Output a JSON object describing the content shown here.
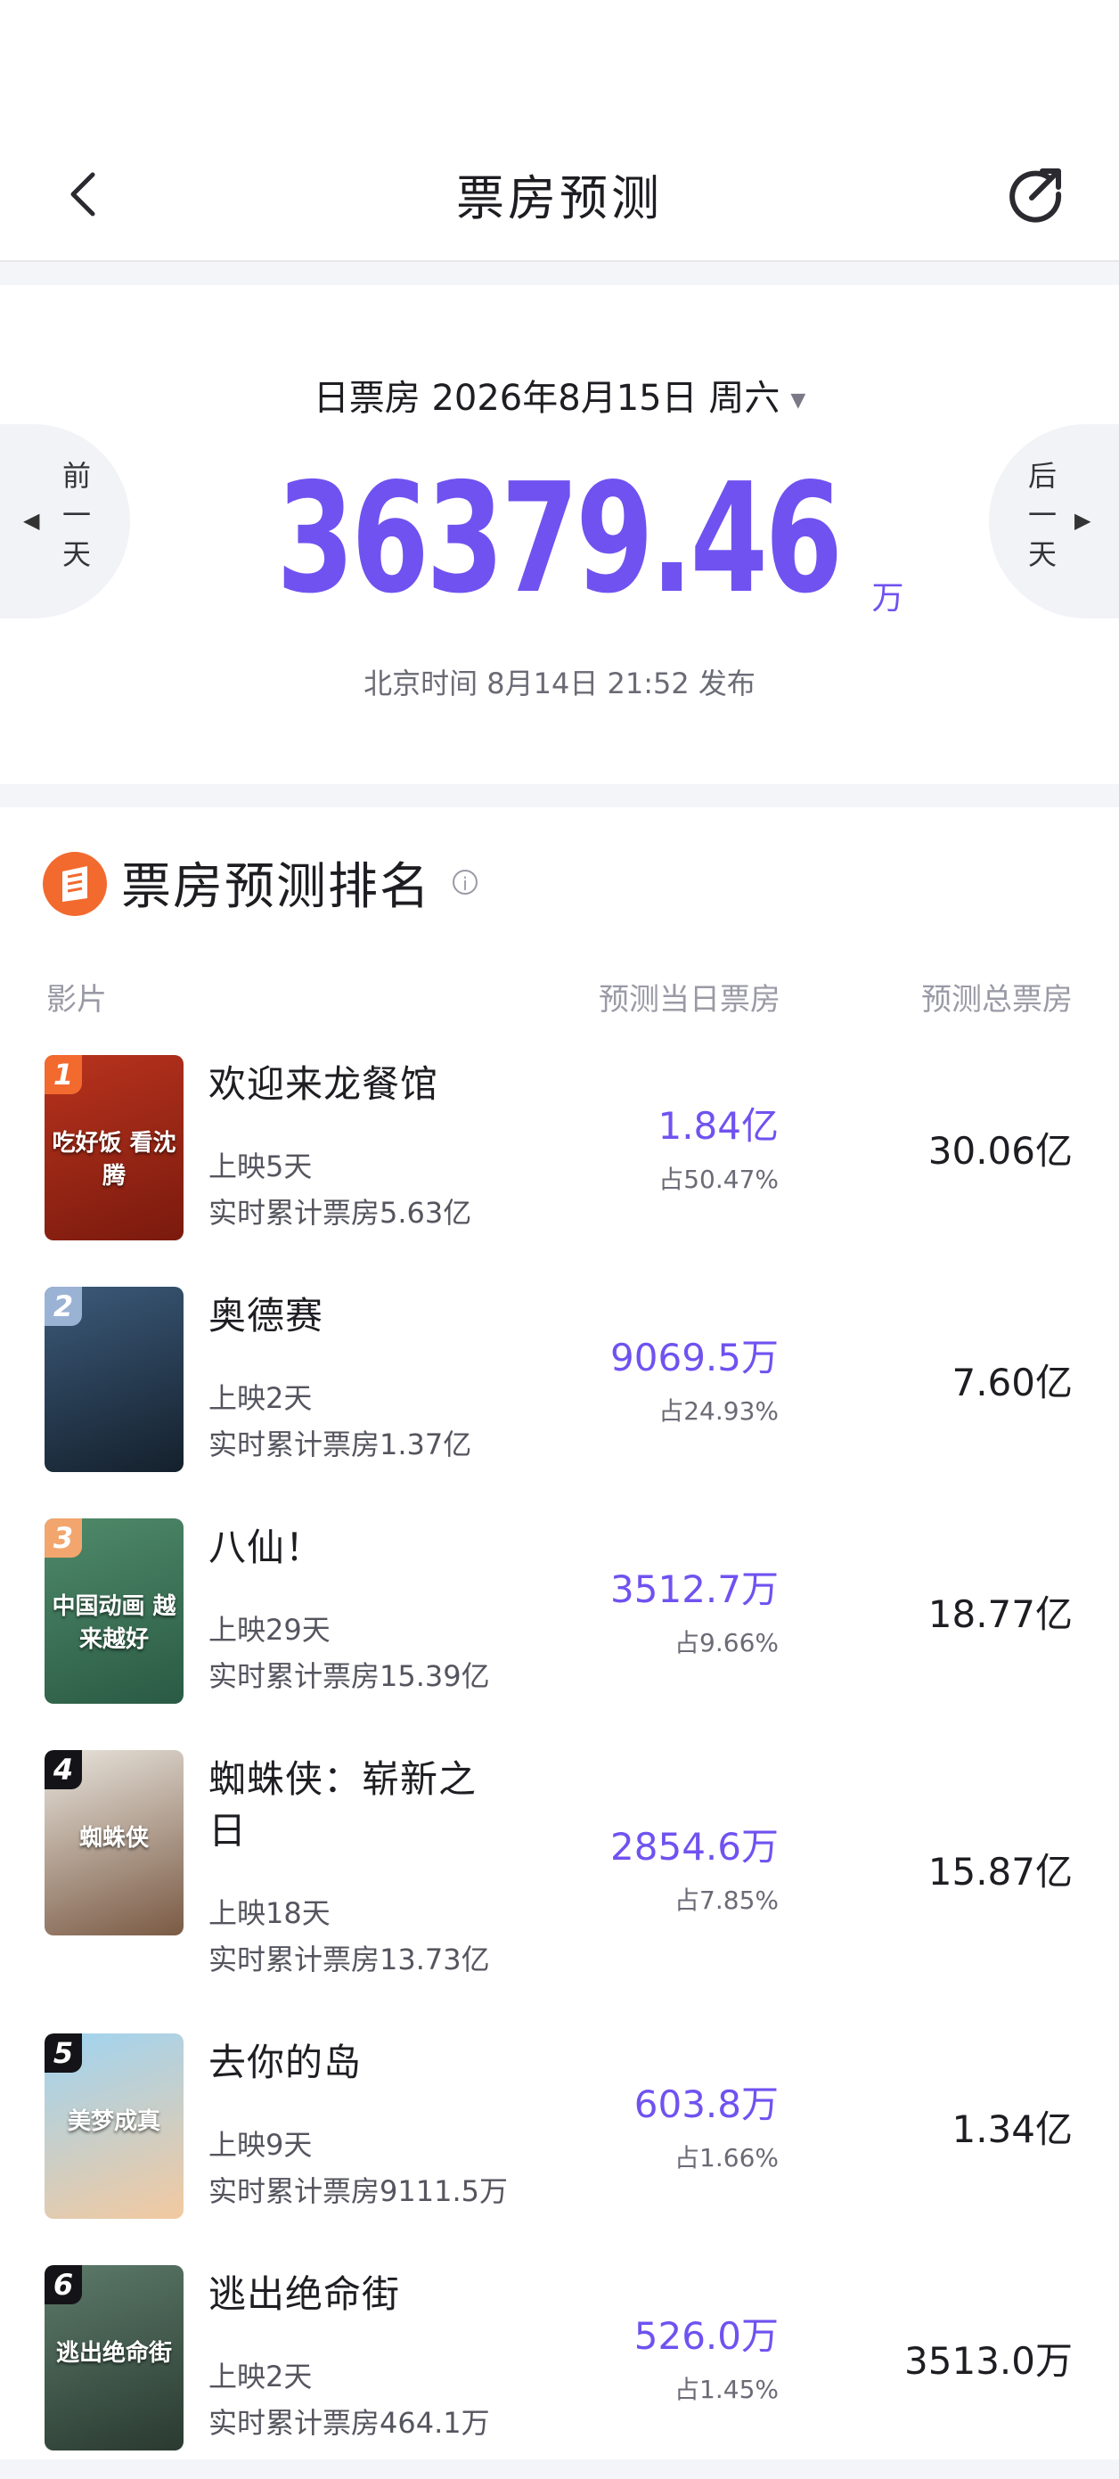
{
  "header": {
    "title": "票房预测"
  },
  "summary": {
    "date_label": "日票房 2026年8月15日 周六",
    "prev_day": "前一天",
    "next_day": "后一天",
    "total_value": "36379.46",
    "total_unit": "万",
    "publish_time": "北京时间 8月14日 21:52 发布"
  },
  "ranking": {
    "title": "票房预测排名",
    "columns": {
      "film": "影片",
      "day": "预测当日票房",
      "total": "预测总票房"
    },
    "items": [
      {
        "rank": "1",
        "title": "欢迎来龙餐馆",
        "days": "上映5天",
        "cumulative": "实时累计票房5.63亿",
        "day_box": "1.84亿",
        "share": "占50.47%",
        "total": "30.06亿",
        "badge_color": "#f26a2e",
        "poster_colors": [
          "#b8331d",
          "#7a1a0e"
        ],
        "poster_text": "吃好饭 看沈腾"
      },
      {
        "rank": "2",
        "title": "奥德赛",
        "days": "上映2天",
        "cumulative": "实时累计票房1.37亿",
        "day_box": "9069.5万",
        "share": "占24.93%",
        "total": "7.60亿",
        "badge_color": "#9ab2d4",
        "poster_colors": [
          "#3c5a7a",
          "#14202c"
        ],
        "poster_text": ""
      },
      {
        "rank": "3",
        "title": "八仙！",
        "days": "上映29天",
        "cumulative": "实时累计票房15.39亿",
        "day_box": "3512.7万",
        "share": "占9.66%",
        "total": "18.77亿",
        "badge_color": "#f2a66e",
        "poster_colors": [
          "#4f8a6a",
          "#2a5a44"
        ],
        "poster_text": "中国动画 越来越好"
      },
      {
        "rank": "4",
        "title": "蜘蛛侠：崭新之日",
        "days": "上映18天",
        "cumulative": "实时累计票房13.73亿",
        "day_box": "2854.6万",
        "share": "占7.85%",
        "total": "15.87亿",
        "badge_color": "#141418",
        "poster_colors": [
          "#e8e4dc",
          "#7a5a44"
        ],
        "poster_text": "蜘蛛侠"
      },
      {
        "rank": "5",
        "title": "去你的岛",
        "days": "上映9天",
        "cumulative": "实时累计票房9111.5万",
        "day_box": "603.8万",
        "share": "占1.66%",
        "total": "1.34亿",
        "badge_color": "#141418",
        "poster_colors": [
          "#9fd4f2",
          "#f2c9a0"
        ],
        "poster_text": "美梦成真"
      },
      {
        "rank": "6",
        "title": "逃出绝命街",
        "days": "上映2天",
        "cumulative": "实时累计票房464.1万",
        "day_box": "526.0万",
        "share": "占1.45%",
        "total": "3513.0万",
        "badge_color": "#141418",
        "poster_colors": [
          "#5c7a6a",
          "#2a3a30"
        ],
        "poster_text": "逃出绝命街"
      }
    ]
  },
  "colors": {
    "accent": "#7052f0",
    "icon_orange": "#f26a2e"
  }
}
